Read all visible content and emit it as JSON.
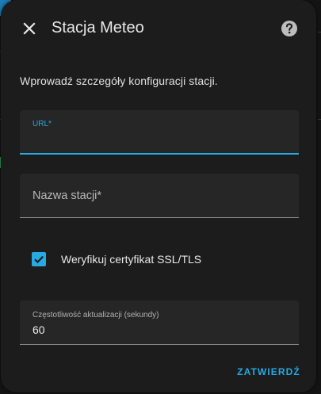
{
  "dialog": {
    "title": "Stacja Meteo",
    "description": "Wprowadź szczegóły konfiguracji stacji.",
    "close_icon": "close-icon",
    "help_icon": "help-circle-icon"
  },
  "form": {
    "url": {
      "label": "URL*",
      "value": ""
    },
    "station_name": {
      "label": "Nazwa stacji*",
      "value": ""
    },
    "verify_ssl": {
      "label": "Weryfikuj certyfikat SSL/TLS",
      "checked": true
    },
    "update_interval": {
      "label": "Częstotliwość aktualizacji (sekundy)",
      "value": "60"
    }
  },
  "actions": {
    "submit_label": "ZATWIERDŹ"
  },
  "colors": {
    "accent": "#27a9e3",
    "dialog_bg": "#1c1c1c",
    "field_bg": "#262626",
    "text": "#e8e8e8"
  }
}
